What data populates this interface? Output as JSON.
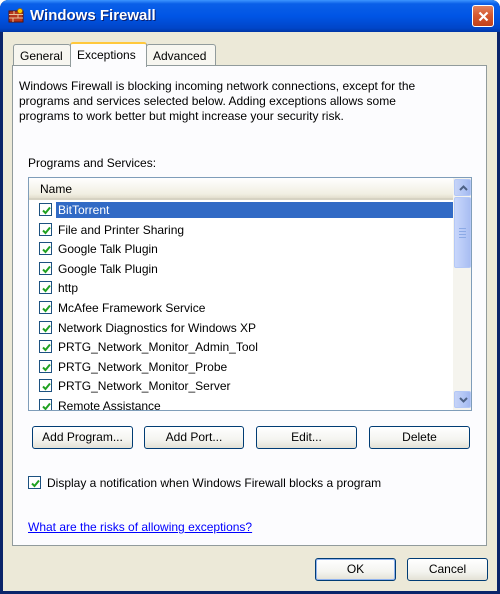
{
  "window": {
    "title": "Windows Firewall"
  },
  "tabs": [
    {
      "label": "General"
    },
    {
      "label": "Exceptions"
    },
    {
      "label": "Advanced"
    }
  ],
  "description": "Windows Firewall is blocking incoming network connections, except for the programs and services selected below. Adding exceptions allows some programs to work better but might increase your security risk.",
  "programs": {
    "section_label": "Programs and Services:",
    "column_header": "Name",
    "items": [
      {
        "label": "BitTorrent",
        "checked": true,
        "selected": true
      },
      {
        "label": "File and Printer Sharing",
        "checked": true
      },
      {
        "label": "Google Talk Plugin",
        "checked": true
      },
      {
        "label": "Google Talk Plugin",
        "checked": true
      },
      {
        "label": "http",
        "checked": true
      },
      {
        "label": "McAfee Framework Service",
        "checked": true
      },
      {
        "label": "Network Diagnostics for Windows XP",
        "checked": true
      },
      {
        "label": "PRTG_Network_Monitor_Admin_Tool",
        "checked": true
      },
      {
        "label": "PRTG_Network_Monitor_Probe",
        "checked": true
      },
      {
        "label": "PRTG_Network_Monitor_Server",
        "checked": true
      },
      {
        "label": "Remote Assistance",
        "checked": true
      }
    ]
  },
  "actions": {
    "add_program": "Add Program...",
    "add_port": "Add Port...",
    "edit": "Edit...",
    "delete": "Delete"
  },
  "notification": {
    "label": "Display a notification when Windows Firewall blocks a program",
    "checked": true
  },
  "risk_link": "What are the risks of allowing exceptions?",
  "dialog_buttons": {
    "ok": "OK",
    "cancel": "Cancel"
  },
  "colors": {
    "titlebar": "#0055e5",
    "selection": "#316ac5",
    "face": "#ece9d8",
    "link": "#0000ff"
  }
}
